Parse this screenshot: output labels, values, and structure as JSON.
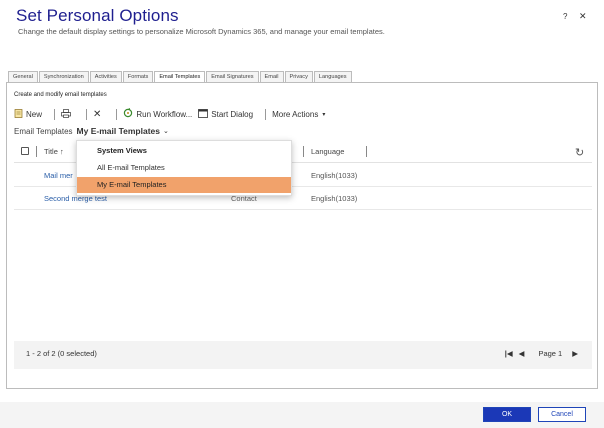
{
  "dialog": {
    "title": "Set Personal Options",
    "subtitle": "Change the default display settings to personalize Microsoft Dynamics 365, and manage your email templates.",
    "help": "?",
    "close": "✕"
  },
  "tabs": [
    {
      "label": "General"
    },
    {
      "label": "Synchronization"
    },
    {
      "label": "Activities"
    },
    {
      "label": "Formats"
    },
    {
      "label": "Email Templates"
    },
    {
      "label": "Email Signatures"
    },
    {
      "label": "Email"
    },
    {
      "label": "Privacy"
    },
    {
      "label": "Languages"
    }
  ],
  "section_title": "Create and modify email templates",
  "toolbar": {
    "new_label": "New",
    "run_workflow_label": "Run Workflow...",
    "start_dialog_label": "Start Dialog",
    "more_actions_label": "More Actions"
  },
  "view": {
    "label": "Email Templates",
    "selected": "My E-mail Templates"
  },
  "grid": {
    "columns": {
      "title": "Title ↑",
      "language": "Language"
    },
    "rows": [
      {
        "title": "Mail mer",
        "type": "",
        "language": "English(1033)"
      },
      {
        "title": "Second merge test",
        "type": "Contact",
        "language": "English(1033)"
      }
    ],
    "footer": {
      "count": "1 - 2 of 2 (0 selected)",
      "page": "Page 1"
    }
  },
  "dropdown": {
    "header": "System Views",
    "items": [
      "All E-mail Templates",
      "My E-mail Templates"
    ],
    "selected_index": 1
  },
  "buttons": {
    "ok": "OK",
    "cancel": "Cancel"
  },
  "colors": {
    "title_blue": "#1f1f8f",
    "link_blue": "#2a5ea8",
    "highlight": "#f1a26b",
    "primary_button": "#1b38b7"
  }
}
